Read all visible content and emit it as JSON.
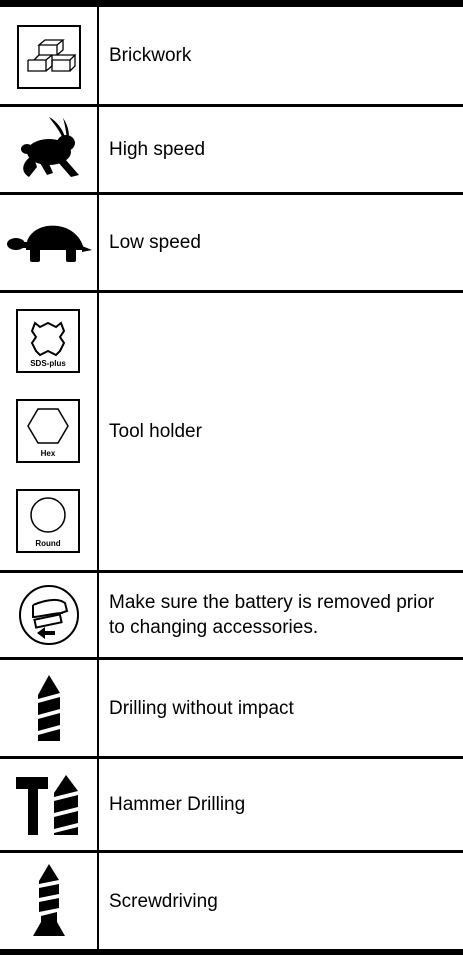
{
  "rows": [
    {
      "icon": "brickwork-icon",
      "label": "Brickwork"
    },
    {
      "icon": "rabbit-icon",
      "label": "High speed"
    },
    {
      "icon": "turtle-icon",
      "label": "Low speed"
    },
    {
      "icon": "tool-holder-icons",
      "label": "Tool holder",
      "icons": [
        {
          "icon": "sds-plus-icon",
          "caption": "SDS-plus"
        },
        {
          "icon": "hex-icon",
          "caption": "Hex"
        },
        {
          "icon": "round-icon",
          "caption": "Round"
        }
      ]
    },
    {
      "icon": "battery-removal-icon",
      "label": "Make sure the battery is removed prior to changing accessories."
    },
    {
      "icon": "drill-bit-icon",
      "label": "Drilling without impact"
    },
    {
      "icon": "hammer-drill-icon",
      "label": "Hammer Drilling"
    },
    {
      "icon": "screwdriver-bit-icon",
      "label": "Screwdriving"
    }
  ]
}
